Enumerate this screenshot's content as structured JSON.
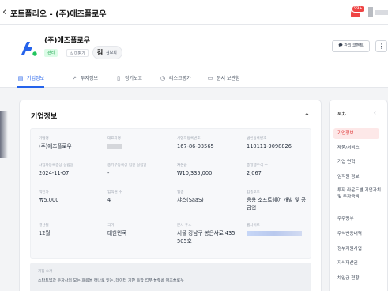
{
  "header": {
    "back_icon": "chevron-left-icon",
    "title": "포트폴리오 - (주)애즈플로우",
    "notification_badge": "99+"
  },
  "company": {
    "name": "(주)애즈플로우",
    "tag_managed": "관리",
    "tag_status": "⚠ 미평가",
    "manager_initial": "김",
    "manager_name": "김보희",
    "comment_button": "🗩 관리 코멘트",
    "more_button": "⋮"
  },
  "tabs": [
    {
      "label": "기업정보",
      "icon": "building-icon"
    },
    {
      "label": "투자정보",
      "icon": "trend-up-icon"
    },
    {
      "label": "정기보고",
      "icon": "document-icon"
    },
    {
      "label": "리스크평가",
      "icon": "clock-icon"
    },
    {
      "label": "문서 보관함",
      "icon": "folder-icon"
    }
  ],
  "section": {
    "title": "기업정보",
    "collapse_icon": "chevron-up-icon"
  },
  "fields": [
    {
      "label": "기업명",
      "value": "(주)애즈플로우"
    },
    {
      "label": "대표자명",
      "value": ""
    },
    {
      "label": "사업자등록번호",
      "value": "167-86-03565"
    },
    {
      "label": "법인등록번호",
      "value": "110111-9098826"
    },
    {
      "label": "사업자등록증상 설립일",
      "value": "2024-11-07"
    },
    {
      "label": "중기부등록상 법인 설립일",
      "value": "-"
    },
    {
      "label": "자본금",
      "value": "₩10,335,000"
    },
    {
      "label": "총발행주식 수",
      "value": "2,067"
    },
    {
      "label": "액면가",
      "value": "₩5,000"
    },
    {
      "label": "임직원 수",
      "value": "4"
    },
    {
      "label": "업종",
      "value": "샤스(SaaS)"
    },
    {
      "label": "업종코드",
      "value": "응용 소프트웨어 개발 및 공\n급업"
    },
    {
      "label": "결산월",
      "value": "12월"
    },
    {
      "label": "국가",
      "value": "대한민국"
    },
    {
      "label": "본사 주소",
      "value": "서울 강남구 봉은사로 435\n505호"
    },
    {
      "label": "웹사이트",
      "value": ""
    }
  ],
  "description": {
    "label": "기업 소개",
    "text": "스타트업과 투자사의 모든 흐름을 하나로 잇는, 데이터 기반 통합 업무 플랫폼 애즈플로우"
  },
  "toc": {
    "title": "목차",
    "items": [
      "기업정보",
      "제품/서비스",
      "기업 연혁",
      "임직원 정보",
      "투자 라운드별 기업가치 및 투자금액",
      "주주명부",
      "주식변동내역",
      "정부지원사업",
      "지식재산권",
      "차입금 현황"
    ]
  },
  "colors": {
    "accent": "#2563eb",
    "toc_active": "#dc2626",
    "tag_green": "#16a34a"
  }
}
